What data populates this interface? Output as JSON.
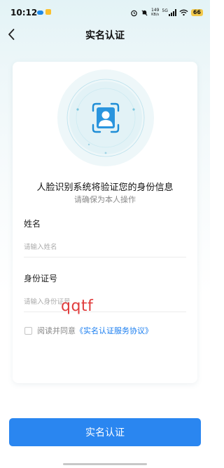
{
  "status_bar": {
    "time": "10:12",
    "net_speed_value": "149",
    "net_speed_unit": "KB/s",
    "network_type": "5G",
    "battery_level": "66"
  },
  "header": {
    "title": "实名认证",
    "back_icon": "chevron-left-icon"
  },
  "card": {
    "face_icon": "face-scan-icon",
    "headline": "人脸识别系统将验证您的身份信息",
    "subline": "请确保为本人操作",
    "name_field": {
      "label": "姓名",
      "placeholder": "请输入姓名",
      "value": ""
    },
    "id_field": {
      "label": "身份证号",
      "placeholder": "请输入身份证号",
      "value": ""
    },
    "agreement": {
      "checked": false,
      "prefix": "阅读并同意",
      "link": "《实名认证服务协议》"
    }
  },
  "watermark": "qqtf",
  "footer": {
    "submit_label": "实名认证"
  },
  "colors": {
    "accent": "#2a86f0",
    "link": "#1a7ef0",
    "watermark": "#e03c3c",
    "background_top": "#e3f3f6"
  }
}
